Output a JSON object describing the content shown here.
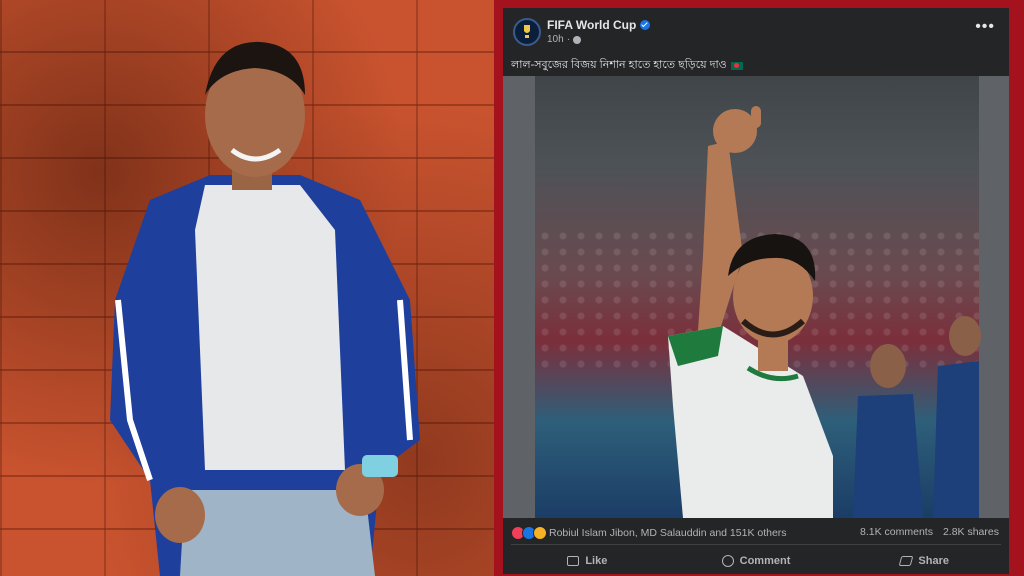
{
  "post": {
    "page_name": "FIFA World Cup",
    "time": "10h",
    "caption": "লাল-সবুজের বিজয় নিশান হাতে হাতে ছড়িয়ে দাও",
    "reactions_text": "Robiul Islam Jibon, MD Salauddin and 151K others",
    "comments": "8.1K comments",
    "shares": "2.8K shares",
    "actions": {
      "like": "Like",
      "comment": "Comment",
      "share": "Share"
    }
  },
  "icons": [
    "verified-icon",
    "globe-icon",
    "more-icon",
    "flag-icon",
    "love-icon",
    "like-icon",
    "wow-icon",
    "comment-icon",
    "share-icon"
  ],
  "colors": {
    "frame": "#a3121d",
    "post_bg": "#242526",
    "text": "#e4e6eb",
    "muted": "#b0b3b8",
    "brand": "#1b74e4"
  }
}
